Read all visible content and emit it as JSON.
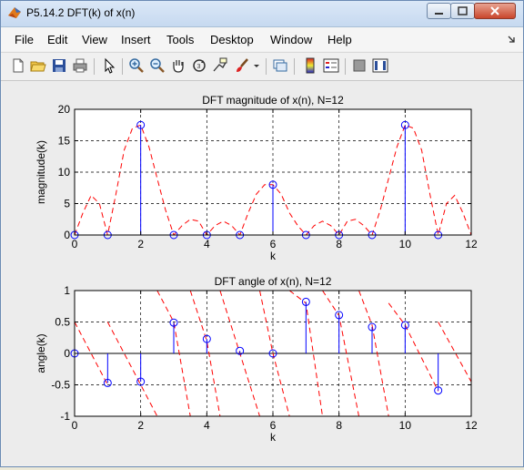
{
  "window": {
    "title": "P5.14.2 DFT(k) of x(n)"
  },
  "menu": [
    "File",
    "Edit",
    "View",
    "Insert",
    "Tools",
    "Desktop",
    "Window",
    "Help"
  ],
  "toolbar_icons": [
    "new-file-icon",
    "open-folder-icon",
    "save-icon",
    "print-icon",
    "pointer-icon",
    "zoom-in-icon",
    "zoom-out-icon",
    "pan-hand-icon",
    "rotate-3d-icon",
    "data-cursor-icon",
    "brush-icon",
    "brush-dropdown-icon",
    "link-plot-icon",
    "colorbar-icon",
    "legend-icon",
    "hide-plot-tools-icon",
    "show-plot-tools-icon"
  ],
  "chart_data": [
    {
      "type": "stem",
      "title": "DFT magnitude of x(n), N=12",
      "xlabel": "k",
      "ylabel": "magnitude(k)",
      "xlim": [
        0,
        12
      ],
      "ylim": [
        0,
        20
      ],
      "xticks": [
        0,
        2,
        4,
        6,
        8,
        10,
        12
      ],
      "yticks": [
        0,
        5,
        10,
        15,
        20
      ],
      "grid": true,
      "stem": {
        "k": [
          0,
          1,
          2,
          3,
          4,
          5,
          6,
          7,
          8,
          9,
          10,
          11
        ],
        "values": [
          0,
          0,
          17.5,
          0,
          0,
          0,
          8,
          0,
          0,
          0,
          17.5,
          0
        ],
        "color": "#0000ff"
      },
      "curve": {
        "style": "dashed",
        "color": "#ff0000",
        "x": [
          0,
          0.25,
          0.5,
          0.75,
          1,
          1.25,
          1.5,
          1.75,
          2,
          2.25,
          2.5,
          2.75,
          3,
          3.25,
          3.5,
          3.75,
          4,
          4.25,
          4.5,
          4.75,
          5,
          5.25,
          5.5,
          5.75,
          6,
          6.25,
          6.5,
          6.75,
          7,
          7.25,
          7.5,
          7.75,
          8,
          8.25,
          8.5,
          8.75,
          9,
          9.25,
          9.5,
          9.75,
          10,
          10.25,
          10.5,
          10.75,
          11,
          11.25,
          11.5,
          11.75,
          12
        ],
        "y": [
          0,
          3.5,
          6.3,
          5,
          0,
          6.5,
          13.5,
          17,
          17.5,
          14,
          9,
          4,
          0,
          1.5,
          2.5,
          2.2,
          0,
          1.5,
          2.2,
          1.5,
          0,
          3.5,
          6.5,
          8,
          8,
          6.5,
          3.5,
          1.5,
          0,
          1.5,
          2.2,
          1.5,
          0,
          2.2,
          2.5,
          1.5,
          0,
          4,
          9,
          14,
          17.5,
          17,
          13.5,
          6.5,
          0,
          5,
          6.3,
          3.5,
          0
        ]
      }
    },
    {
      "type": "stem",
      "title": "DFT angle of x(n), N=12",
      "xlabel": "k",
      "ylabel": "angle(k)",
      "xlim": [
        0,
        12
      ],
      "ylim": [
        -1,
        1
      ],
      "xticks": [
        0,
        2,
        4,
        6,
        8,
        10,
        12
      ],
      "yticks": [
        -1,
        -0.5,
        0,
        0.5,
        1
      ],
      "grid": true,
      "stem": {
        "k": [
          0,
          1,
          2,
          3,
          4,
          5,
          6,
          7,
          8,
          9,
          10,
          11
        ],
        "values": [
          0,
          -0.47,
          -0.45,
          0.49,
          0.23,
          0.04,
          0,
          0.82,
          0.61,
          0.42,
          0.45,
          -0.59
        ],
        "color": "#0000ff"
      },
      "curve": {
        "style": "dashed",
        "color": "#ff0000",
        "segments": [
          {
            "x": [
              0,
              1
            ],
            "y": [
              0.5,
              -0.5
            ]
          },
          {
            "x": [
              1,
              2,
              2.5
            ],
            "y": [
              0.5,
              -0.5,
              -1
            ]
          },
          {
            "x": [
              2.5,
              3,
              3.5
            ],
            "y": [
              1,
              0.5,
              -1
            ]
          },
          {
            "x": [
              3.5,
              4,
              4.4
            ],
            "y": [
              1,
              0.2,
              -1
            ]
          },
          {
            "x": [
              4.4,
              5,
              5.6
            ],
            "y": [
              1,
              0,
              -1
            ]
          },
          {
            "x": [
              5.6,
              6,
              6.5
            ],
            "y": [
              1,
              0,
              -1
            ]
          },
          {
            "x": [
              6.5,
              7,
              7.5
            ],
            "y": [
              1,
              0.8,
              -1
            ]
          },
          {
            "x": [
              7.5,
              8,
              8.6
            ],
            "y": [
              1,
              0.6,
              -1
            ]
          },
          {
            "x": [
              8.6,
              9,
              9.5
            ],
            "y": [
              1,
              0.45,
              -1
            ]
          },
          {
            "x": [
              9.5,
              10,
              11
            ],
            "y": [
              0.8,
              0.45,
              -0.6
            ]
          },
          {
            "x": [
              11,
              12
            ],
            "y": [
              0.5,
              -0.45
            ]
          }
        ]
      }
    }
  ]
}
